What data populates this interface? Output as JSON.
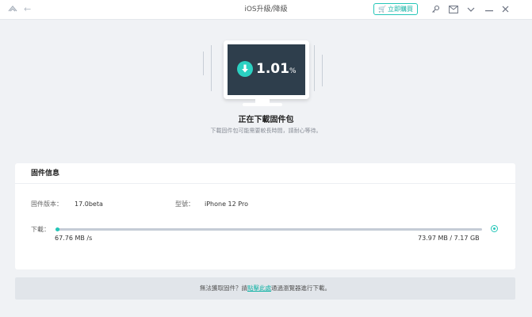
{
  "window": {
    "title": "iOS升級/降級",
    "buy_label": "立即購買",
    "icons": [
      "app-logo-icon",
      "back-arrow-icon",
      "cart-icon",
      "key-icon",
      "feedback-icon",
      "dropdown-icon",
      "minimize-icon",
      "close-icon"
    ]
  },
  "progress": {
    "percent_value": "1.01",
    "percent_sign": "%",
    "fraction": 0.0101,
    "status_title": "正在下載固件包",
    "status_subtitle": "下載固件包可能需要較長時間，請耐心等待。"
  },
  "firmware": {
    "section_title": "固件信息",
    "version_label": "固件版本：",
    "version_value": "17.0beta",
    "model_label": "型號：",
    "model_value": "iPhone 12 Pro",
    "download_label": "下載：",
    "speed": "67.76 MB /s",
    "size": "73.97 MB / 7.17 GB"
  },
  "footer": {
    "prefix": "無法獲取固件？請",
    "link": "點擊此處",
    "suffix": "通過瀏覽器進行下載。"
  },
  "colors": {
    "accent": "#24c6b8",
    "monitor_screen": "#2e3e4c",
    "background": "#f0f2f5"
  }
}
